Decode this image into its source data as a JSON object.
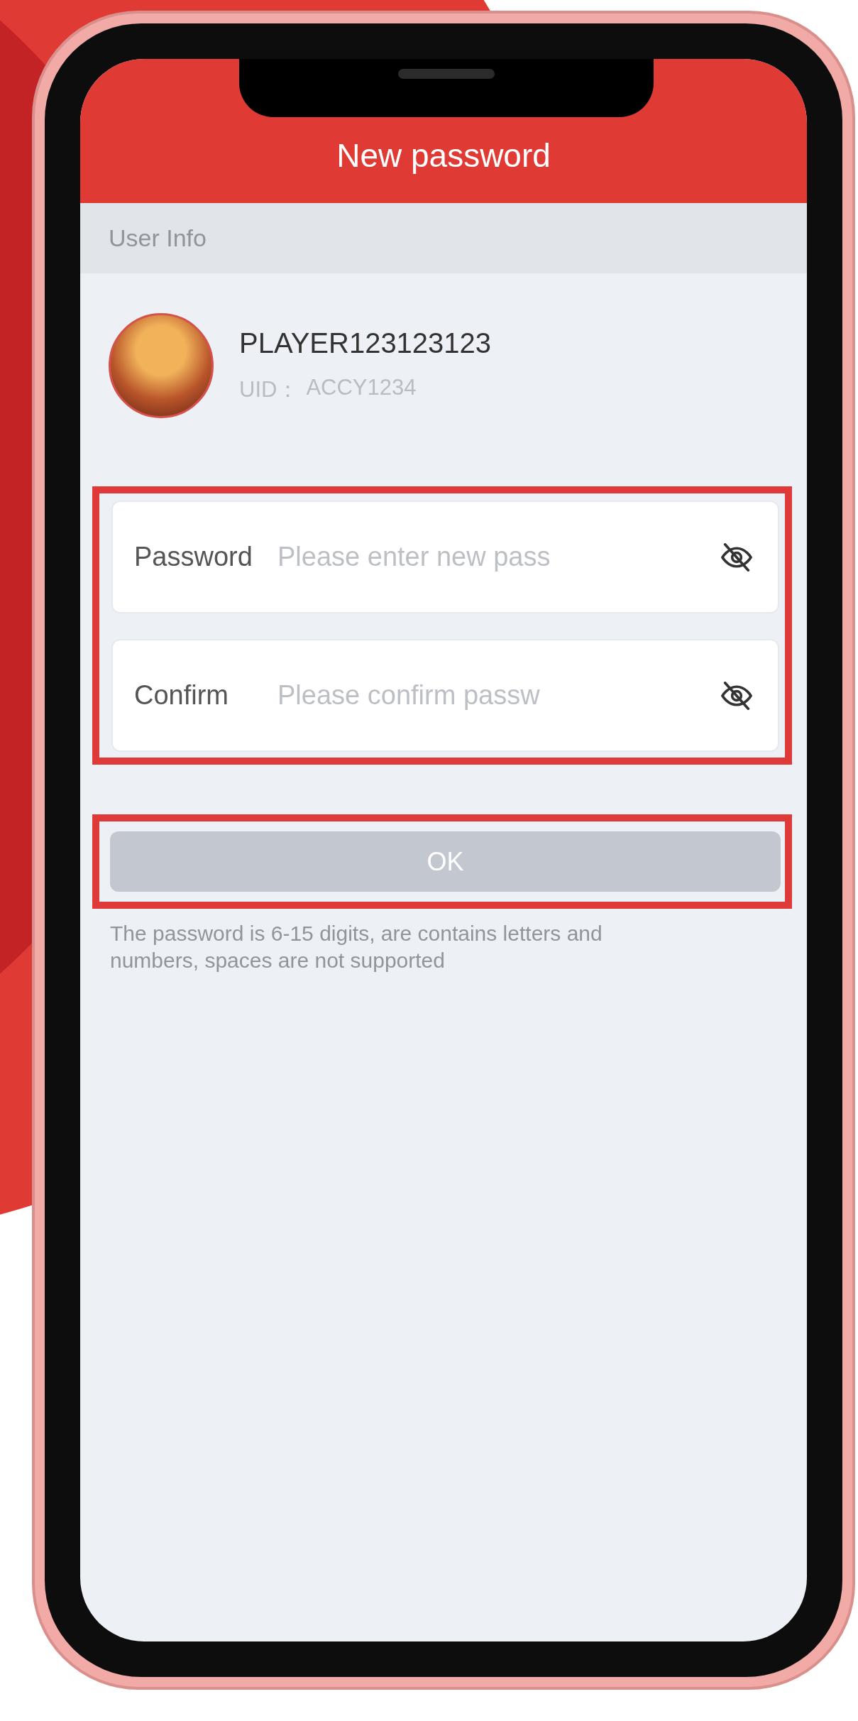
{
  "header": {
    "title": "New password"
  },
  "section": {
    "title": "User Info"
  },
  "user": {
    "name": "PLAYER123123123",
    "uid_label": "UID：",
    "uid": "ACCY1234"
  },
  "fields": [
    {
      "label": "Password",
      "placeholder": "Please enter new pass",
      "hidden": true
    },
    {
      "label": "Confirm",
      "placeholder": "Please confirm passw",
      "hidden": true
    }
  ],
  "ok_button": {
    "label": "OK",
    "disabled": true
  },
  "hint": "The password is 6-15 digits, are contains letters and numbers, spaces are not supported"
}
